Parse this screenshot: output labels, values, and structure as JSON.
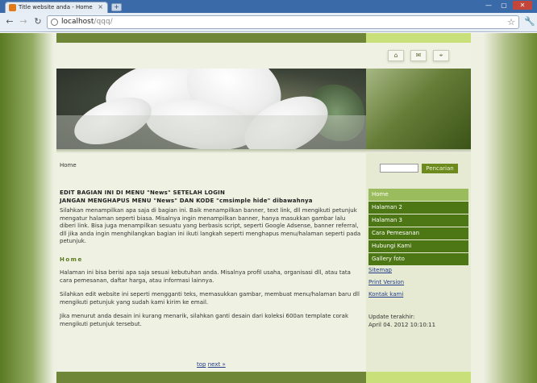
{
  "browser": {
    "tab_title": "Title website anda - Home",
    "tab_close": "×",
    "new_tab": "+",
    "url_host": "localhost",
    "url_path": "/qqq/",
    "win_min": "—",
    "win_max": "▢",
    "win_close": "✕",
    "icons": {
      "back": "back-arrow-icon",
      "forward": "forward-arrow-icon",
      "reload": "reload-icon",
      "star": "star-icon",
      "wrench": "wrench-icon"
    }
  },
  "header": {
    "icons": [
      "home-icon",
      "mail-icon",
      "sitemap-icon"
    ]
  },
  "main": {
    "breadcrumb": "Home",
    "notice_line1": "EDIT BAGIAN INI DI MENU \"News\" SETELAH LOGIN",
    "notice_line2": "JANGAN MENGHAPUS MENU \"News\" DAN KODE \"cmsimple hide\" dibawahnya",
    "para1": "Silahkan menampilkan apa saja di bagian ini. Baik menampilkan banner, text link, dll mengikuti petunjuk mengatur halaman seperti biasa. Misalnya ingin menampilkan banner, hanya masukkan gambar lalu diberi link. Bisa juga menampilkan sesuatu yang berbasis script, seperti Google Adsense, banner referral, dll jika anda ingin menghilangkan bagian ini ikuti langkah seperti menghapus menu/halaman seperti pada petunjuk.",
    "section_title": "Home",
    "para2": "Halaman ini bisa berisi apa saja sesuai kebutuhan anda. Misalnya profil usaha, organisasi dll, atau tata cara pemesanan, daftar harga, atau informasi lainnya.",
    "para3": "Silahkan edit website ini seperti mengganti teks, memasukkan gambar, membuat menu/halaman baru dll mengikuti petunjuk yang sudah kami kirim ke email.",
    "para4": "Jika menurut anda desain ini kurang menarik, silahkan ganti desain dari koleksi 600an template corak mengikuti petunjuk tersebut.",
    "pager_top": "top",
    "pager_next": "next »"
  },
  "sidebar": {
    "search_button": "Pencarian",
    "search_value": "",
    "menu": [
      {
        "label": "Home",
        "active": true
      },
      {
        "label": "Halaman 2",
        "active": false
      },
      {
        "label": "Halaman 3",
        "active": false
      },
      {
        "label": "Cara Pemesanan",
        "active": false
      },
      {
        "label": "Hubungi Kami",
        "active": false
      },
      {
        "label": "Gallery foto",
        "active": false
      }
    ],
    "links": [
      "Sitemap",
      "Print Version",
      "Kontak kami"
    ],
    "update_label": "Update terakhir:",
    "update_value": "April 04. 2012 10:10:11"
  }
}
